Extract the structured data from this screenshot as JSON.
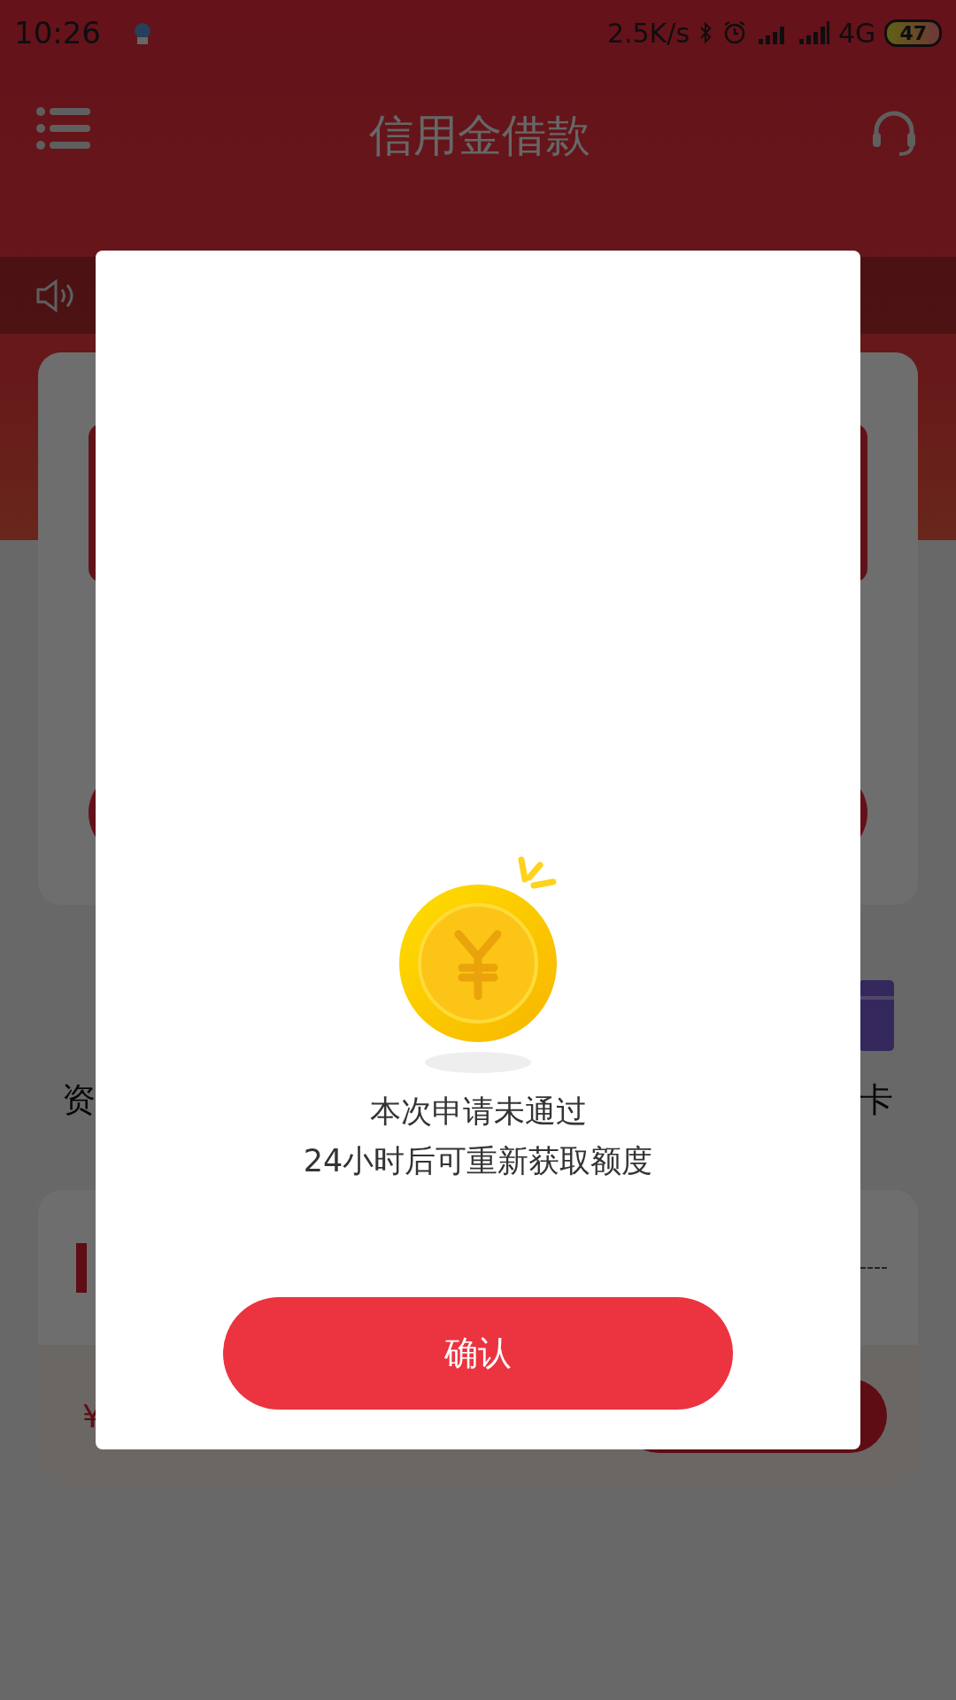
{
  "status_bar": {
    "time": "10:26",
    "net_speed": "2.5K/s",
    "network": "4G",
    "battery": "47"
  },
  "header": {
    "title": "信用金借款"
  },
  "background": {
    "feature_left": "资",
    "feature_right": "卡",
    "amount_symbol": "¥"
  },
  "dialog": {
    "lines": [
      "本次申请未通过",
      "24小时后可重新获取额度"
    ],
    "button": "确认"
  }
}
